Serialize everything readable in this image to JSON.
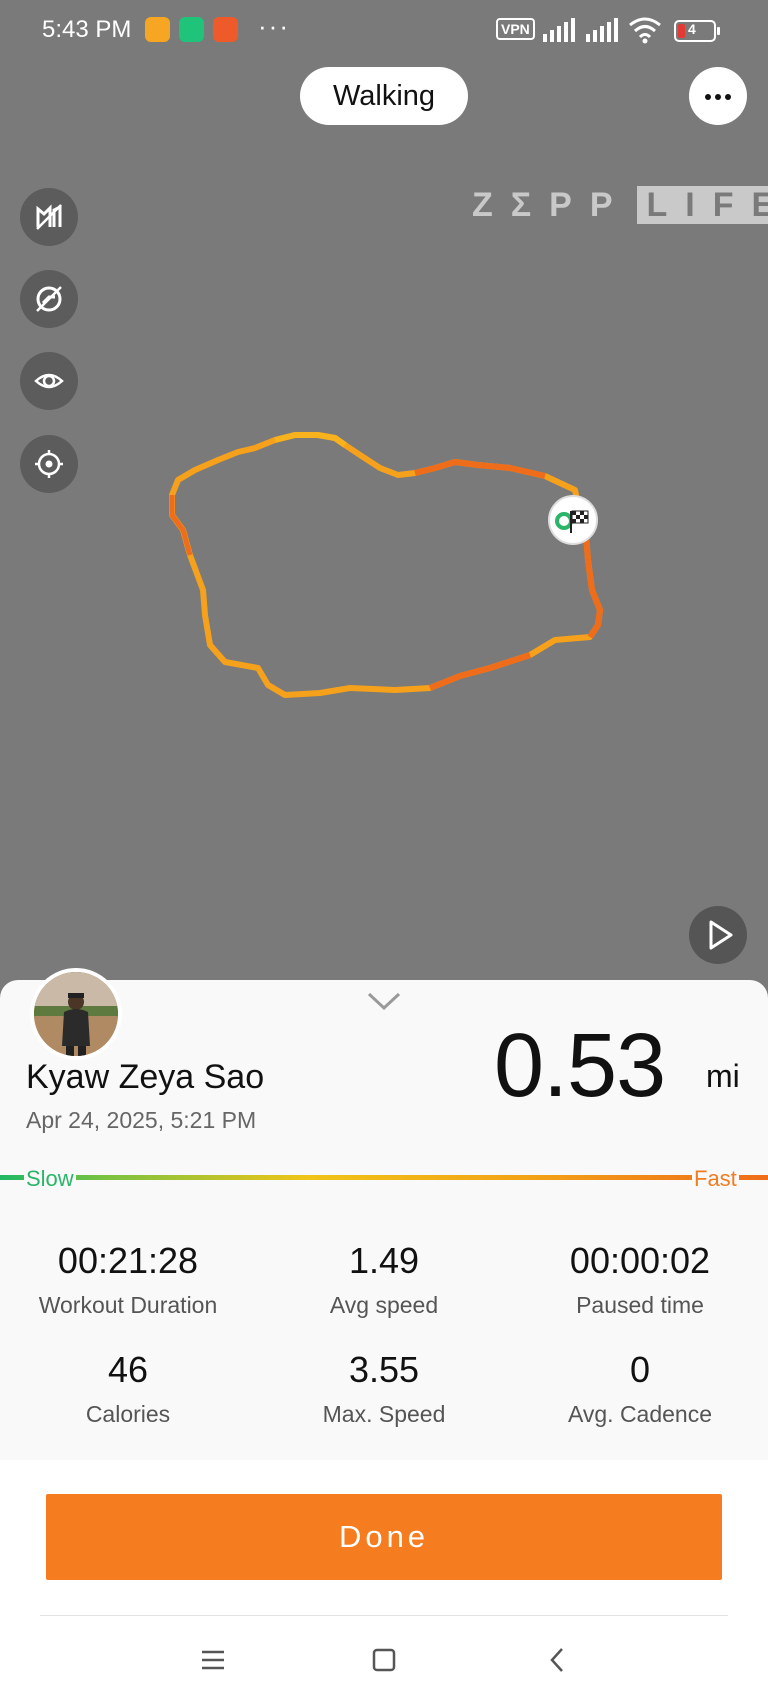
{
  "status_bar": {
    "time": "5:43 PM",
    "dots": "···",
    "vpn": "VPN",
    "battery": "4"
  },
  "map": {
    "activity_label": "Walking",
    "watermark_left": "ZΣPP",
    "watermark_right": "LIFE",
    "route_colors": [
      "#f5a11c",
      "#ef6c1a",
      "#f7b21e"
    ],
    "map_background": "#7a7a7a"
  },
  "icons": {
    "more": "more-icon",
    "map_style": "map-style-icon",
    "hide_route": "hide-route-icon",
    "visibility": "eye-icon",
    "locate": "locate-icon",
    "play": "play-icon",
    "finish_flag": "finish-flag-icon"
  },
  "summary": {
    "user_name": "Kyaw Zeya Sao",
    "datetime": "Apr 24, 2025, 5:21 PM",
    "distance": "0.53",
    "distance_unit": "mi",
    "speed_low_label": "Slow",
    "speed_high_label": "Fast"
  },
  "stats": [
    {
      "value": "00:21:28",
      "label": "Workout Duration"
    },
    {
      "value": "1.49",
      "label": "Avg speed"
    },
    {
      "value": "00:00:02",
      "label": "Paused time"
    },
    {
      "value": "46",
      "label": "Calories"
    },
    {
      "value": "3.55",
      "label": "Max. Speed"
    },
    {
      "value": "0",
      "label": "Avg. Cadence"
    }
  ],
  "actions": {
    "done_label": "Done"
  },
  "colors": {
    "accent": "#f57c1f",
    "slow": "#20b865",
    "fast": "#ef6c1a"
  }
}
